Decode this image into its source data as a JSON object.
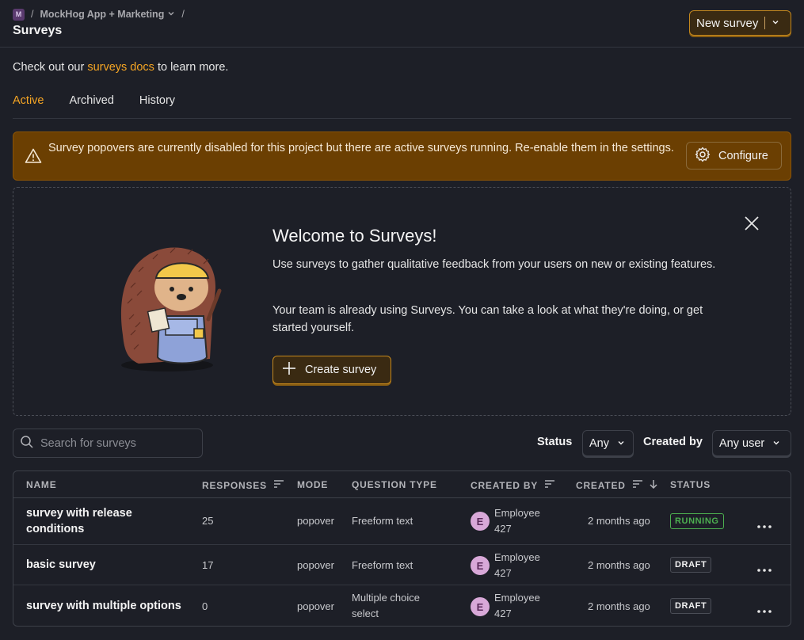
{
  "header": {
    "project_initial": "M",
    "project_name": "MockHog App + Marketing",
    "separator": "/",
    "title": "Surveys",
    "new_survey_label": "New survey"
  },
  "intro": {
    "prefix": "Check out our ",
    "link": "surveys docs",
    "suffix": " to learn more."
  },
  "tabs": [
    {
      "label": "Active",
      "active": true
    },
    {
      "label": "Archived",
      "active": false
    },
    {
      "label": "History",
      "active": false
    }
  ],
  "warning": {
    "text": "Survey popovers are currently disabled for this project but there are active surveys running. Re-enable them in the settings.",
    "button_label": "Configure"
  },
  "welcome": {
    "title": "Welcome to Surveys!",
    "p1": "Use surveys to gather qualitative feedback from your users on new or existing features.",
    "p2": "Your team is already using Surveys. You can take a look at what they're doing, or get started yourself.",
    "create_label": "Create survey"
  },
  "filters": {
    "search_placeholder": "Search for surveys",
    "status_label": "Status",
    "status_value": "Any",
    "created_by_label": "Created by",
    "created_by_value": "Any user"
  },
  "table": {
    "columns": [
      "NAME",
      "RESPONSES",
      "MODE",
      "QUESTION TYPE",
      "CREATED BY",
      "CREATED",
      "STATUS"
    ],
    "rows": [
      {
        "name": "survey with release conditions",
        "responses": "25",
        "mode": "popover",
        "question_type": "Freeform text",
        "creator_initial": "E",
        "creator_line1": "Employee",
        "creator_line2": "427",
        "created": "2 months ago",
        "status": "RUNNING"
      },
      {
        "name": "basic survey",
        "responses": "17",
        "mode": "popover",
        "question_type": "Freeform text",
        "creator_initial": "E",
        "creator_line1": "Employee",
        "creator_line2": "427",
        "created": "2 months ago",
        "status": "DRAFT"
      },
      {
        "name": "survey with multiple options",
        "responses": "0",
        "mode": "popover",
        "question_type_line1": "Multiple choice",
        "question_type_line2": "select",
        "creator_initial": "E",
        "creator_line1": "Employee",
        "creator_line2": "427",
        "created": "2 months ago",
        "status": "DRAFT"
      }
    ]
  },
  "icons": {
    "warning": "warning-triangle-icon",
    "configure": "gear-icon",
    "create": "plus-icon",
    "close": "close-icon",
    "search": "search-icon",
    "sort": "sort-icon",
    "more": "more-horizontal-icon"
  },
  "colors": {
    "accent": "#f5a524",
    "background": "#1d1f27",
    "warning_bg": "#6b3f02",
    "running": "#4caf50"
  }
}
